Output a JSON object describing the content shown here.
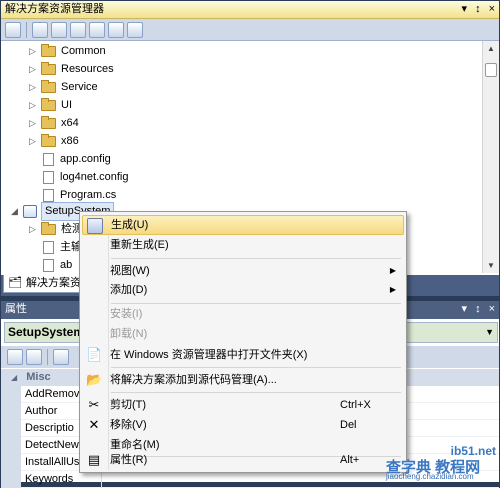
{
  "solution_explorer": {
    "title": "解决方案资源管理器",
    "title_icons": [
      "▾",
      "↕",
      "×"
    ],
    "toolbar_icons": [
      "properties-icon",
      "show-all-files-icon",
      "refresh-icon",
      "view-code-icon",
      "view-designer-icon",
      "class-diagram-icon",
      "copy-website-icon"
    ],
    "tree": [
      {
        "label": "Common",
        "type": "folder",
        "indent": 2
      },
      {
        "label": "Resources",
        "type": "folder",
        "indent": 2
      },
      {
        "label": "Service",
        "type": "folder",
        "indent": 2
      },
      {
        "label": "UI",
        "type": "folder",
        "indent": 2
      },
      {
        "label": "x64",
        "type": "folder",
        "indent": 2
      },
      {
        "label": "x86",
        "type": "folder",
        "indent": 2
      },
      {
        "label": "app.config",
        "type": "file",
        "indent": 2
      },
      {
        "label": "log4net.config",
        "type": "file",
        "indent": 2
      },
      {
        "label": "Program.cs",
        "type": "file",
        "indent": 2
      },
      {
        "label": "SetupSystem",
        "type": "project",
        "indent": 1
      },
      {
        "label": "检测",
        "type": "folder",
        "indent": 2
      },
      {
        "label": "主输",
        "type": "file",
        "indent": 2
      },
      {
        "label": "ab",
        "type": "file",
        "indent": 2
      }
    ],
    "tab_label": "解决方案资"
  },
  "properties": {
    "title": "属性",
    "title_icons": [
      "▾",
      "↕",
      "×"
    ],
    "object_name": "SetupSystem",
    "category": "Misc",
    "rows": [
      "AddRemov",
      "Author",
      "Descriptio",
      "DetectNew",
      "InstallAllUs",
      "Keywords"
    ]
  },
  "context_menu": {
    "items": [
      {
        "label": "生成(U)",
        "icon": "build-icon",
        "highlighted": true
      },
      {
        "label": "重新生成(E)"
      },
      {
        "sep": true
      },
      {
        "label": "视图(W)",
        "submenu": true
      },
      {
        "label": "添加(D)",
        "submenu": true
      },
      {
        "sep": true
      },
      {
        "label": "安装(I)",
        "disabled": true
      },
      {
        "label": "卸载(N)",
        "disabled": true
      },
      {
        "label": "在 Windows 资源管理器中打开文件夹(X)",
        "icon": "open-folder-icon"
      },
      {
        "sep": true
      },
      {
        "label": "将解决方案添加到源代码管理(A)...",
        "icon": "source-control-icon"
      },
      {
        "sep": true
      },
      {
        "label": "剪切(T)",
        "icon": "cut-icon",
        "shortcut": "Ctrl+X"
      },
      {
        "label": "移除(V)",
        "icon": "remove-icon",
        "shortcut": "Del"
      },
      {
        "label": "重命名(M)"
      },
      {
        "sep": true
      },
      {
        "label": "属性(R)",
        "icon": "properties-icon",
        "shortcut": "Alt+"
      }
    ]
  },
  "watermark": {
    "top": "ib51.net",
    "mid": "查字典 教程网",
    "bot": "jiaocheng.chazidian.com"
  },
  "colors": {
    "title_gradient_top": "#fdfcde",
    "title_gradient_bottom": "#f2e28c",
    "panel_frame": "#2b3c59",
    "menu_highlight": "#f7d980"
  }
}
